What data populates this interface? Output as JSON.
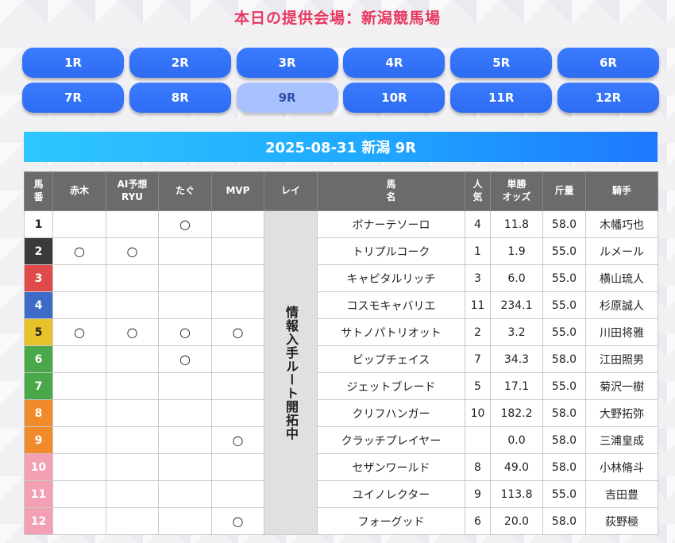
{
  "venue_title": "本日の提供会場：新潟競馬場",
  "races": [
    "1R",
    "2R",
    "3R",
    "4R",
    "5R",
    "6R",
    "7R",
    "8R",
    "9R",
    "10R",
    "11R",
    "12R"
  ],
  "active_race": "9R",
  "race_header": "2025-08-31 新潟 9R",
  "columns": {
    "num": "馬\n番",
    "akagi": "赤木",
    "ai": "AI予想\nRYU",
    "tagu": "たぐ",
    "mvp": "MVP",
    "rei": "レイ",
    "horse": "馬\n名",
    "pop": "人\n気",
    "odds": "単勝\nオッズ",
    "weight": "斤量",
    "jockey": "騎手"
  },
  "rei_notice": "情報入手ルート開拓中",
  "mark_symbol": "○",
  "frame_colors": [
    "#ffffff",
    "#3a3a3a",
    "#e04a4a",
    "#3c6cc8",
    "#e8c22a",
    "#4aa84a",
    "#4aa84a",
    "#f08a2a",
    "#f08a2a",
    "#f3a0b4",
    "#f3a0b4",
    "#f3a0b4"
  ],
  "rows": [
    {
      "num": "1",
      "akagi": "",
      "ai": "",
      "tagu": "○",
      "mvp": "",
      "horse": "ボナーテソーロ",
      "pop": "4",
      "odds": "11.8",
      "weight": "58.0",
      "jockey": "木幡巧也"
    },
    {
      "num": "2",
      "akagi": "○",
      "ai": "○",
      "tagu": "",
      "mvp": "",
      "horse": "トリプルコーク",
      "pop": "1",
      "odds": "1.9",
      "weight": "55.0",
      "jockey": "ルメール"
    },
    {
      "num": "3",
      "akagi": "",
      "ai": "",
      "tagu": "",
      "mvp": "",
      "horse": "キャピタルリッチ",
      "pop": "3",
      "odds": "6.0",
      "weight": "55.0",
      "jockey": "横山琉人"
    },
    {
      "num": "4",
      "akagi": "",
      "ai": "",
      "tagu": "",
      "mvp": "",
      "horse": "コスモキャバリエ",
      "pop": "11",
      "odds": "234.1",
      "weight": "55.0",
      "jockey": "杉原誠人"
    },
    {
      "num": "5",
      "akagi": "○",
      "ai": "○",
      "tagu": "○",
      "mvp": "○",
      "horse": "サトノパトリオット",
      "pop": "2",
      "odds": "3.2",
      "weight": "55.0",
      "jockey": "川田将雅"
    },
    {
      "num": "6",
      "akagi": "",
      "ai": "",
      "tagu": "○",
      "mvp": "",
      "horse": "ビップチェイス",
      "pop": "7",
      "odds": "34.3",
      "weight": "58.0",
      "jockey": "江田照男"
    },
    {
      "num": "7",
      "akagi": "",
      "ai": "",
      "tagu": "",
      "mvp": "",
      "horse": "ジェットブレード",
      "pop": "5",
      "odds": "17.1",
      "weight": "55.0",
      "jockey": "菊沢一樹"
    },
    {
      "num": "8",
      "akagi": "",
      "ai": "",
      "tagu": "",
      "mvp": "",
      "horse": "クリフハンガー",
      "pop": "10",
      "odds": "182.2",
      "weight": "58.0",
      "jockey": "大野拓弥"
    },
    {
      "num": "9",
      "akagi": "",
      "ai": "",
      "tagu": "",
      "mvp": "○",
      "horse": "クラッチプレイヤー",
      "pop": "",
      "odds": "0.0",
      "weight": "58.0",
      "jockey": "三浦皇成"
    },
    {
      "num": "10",
      "akagi": "",
      "ai": "",
      "tagu": "",
      "mvp": "",
      "horse": "セザンワールド",
      "pop": "8",
      "odds": "49.0",
      "weight": "58.0",
      "jockey": "小林脩斗"
    },
    {
      "num": "11",
      "akagi": "",
      "ai": "",
      "tagu": "",
      "mvp": "",
      "horse": "ユイノレクター",
      "pop": "9",
      "odds": "113.8",
      "weight": "55.0",
      "jockey": "吉田豊"
    },
    {
      "num": "12",
      "akagi": "",
      "ai": "",
      "tagu": "",
      "mvp": "○",
      "horse": "フォーグッド",
      "pop": "6",
      "odds": "20.0",
      "weight": "58.0",
      "jockey": "荻野極"
    }
  ]
}
